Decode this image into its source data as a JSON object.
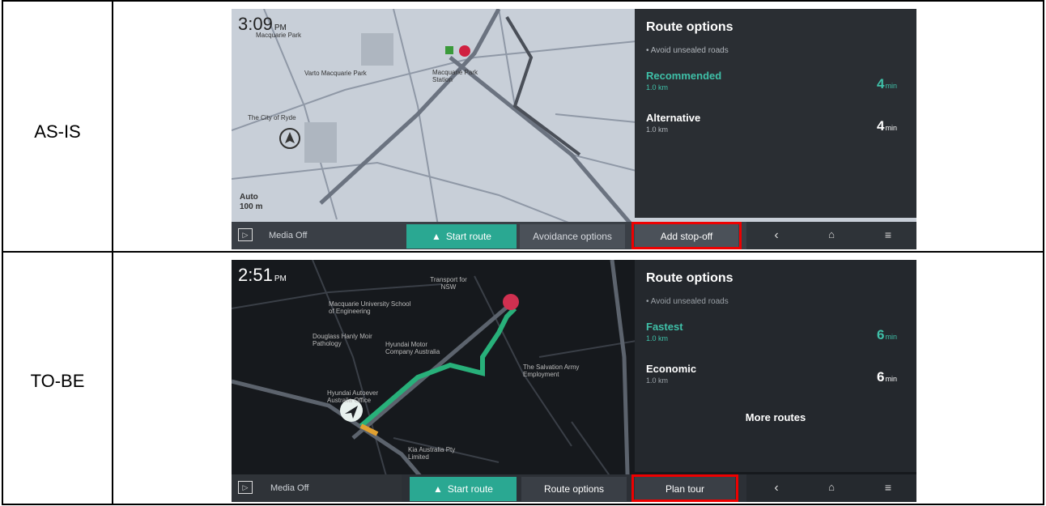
{
  "rows": [
    {
      "label": "AS-IS",
      "time": "3:09",
      "ampm": "PM",
      "scale_line1": "Auto",
      "scale_line2": "100 m",
      "panel": {
        "title": "Route options",
        "avoid": "• Avoid unsealed roads",
        "options": [
          {
            "name": "Recommended",
            "distance": "1.0 km",
            "minutes": "4",
            "unit": "min",
            "accent": "#3fc0a8"
          },
          {
            "name": "Alternative",
            "distance": "1.0 km",
            "minutes": "4",
            "unit": "min",
            "accent": "#ffffff"
          }
        ],
        "more": ""
      },
      "bar": {
        "media": "Media Off",
        "start": "Start route",
        "second": "Avoidance options",
        "third": "Add stop-off"
      },
      "map_labels": [
        "Macquarie Park",
        "Varto Macquarie Park",
        "The City of Ryde",
        "Macquarie Park Station"
      ]
    },
    {
      "label": "TO-BE",
      "time": "2:51",
      "ampm": "PM",
      "panel": {
        "title": "Route options",
        "avoid": "• Avoid unsealed roads",
        "options": [
          {
            "name": "Fastest",
            "distance": "1.0 km",
            "minutes": "6",
            "unit": "min",
            "accent": "#3fc0a8"
          },
          {
            "name": "Economic",
            "distance": "1.0 km",
            "minutes": "6",
            "unit": "min",
            "accent": "#ffffff"
          }
        ],
        "more": "More routes"
      },
      "bar": {
        "media": "Media Off",
        "start": "Start route",
        "second": "Route options",
        "third": "Plan tour"
      },
      "map_labels": [
        "Transport for NSW",
        "Macquarie University School of Engineering",
        "Douglass Hanly Moir Pathology",
        "Hyundai Motor Company Australia",
        "The Salvation Army Employment",
        "Hyundai Autoever Australia Office",
        "Kia Australia Pty Limited"
      ]
    }
  ],
  "colors": {
    "accent": "#3fc0a8",
    "highlight": "#e00000",
    "start_btn": "#2aa892"
  }
}
